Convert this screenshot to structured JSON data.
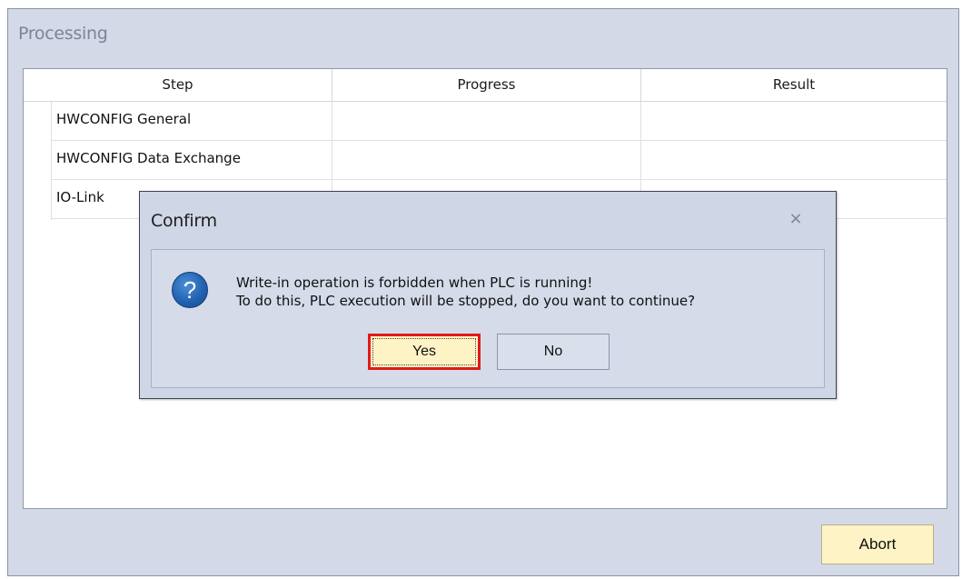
{
  "window": {
    "title": "Processing"
  },
  "table": {
    "columns": [
      "Step",
      "Progress",
      "Result"
    ],
    "rows": [
      {
        "step": "HWCONFIG General",
        "progress": "",
        "result": ""
      },
      {
        "step": "HWCONFIG Data Exchange",
        "progress": "",
        "result": ""
      },
      {
        "step": "IO-Link",
        "progress": "",
        "result": ""
      }
    ]
  },
  "footer": {
    "abort_label": "Abort"
  },
  "dialog": {
    "title": "Confirm",
    "close_glyph": "×",
    "icon": "question-icon",
    "icon_glyph": "?",
    "message_line1": "Write-in operation is forbidden when PLC is running!",
    "message_line2": "To do this, PLC execution will be stopped, do you want to continue?",
    "yes_label": "Yes",
    "no_label": "No"
  },
  "colors": {
    "window_bg": "#d4d9e8",
    "button_accent": "#fdf3c4",
    "highlight_border": "#e01a1a",
    "icon_blue": "#1f5fae"
  }
}
